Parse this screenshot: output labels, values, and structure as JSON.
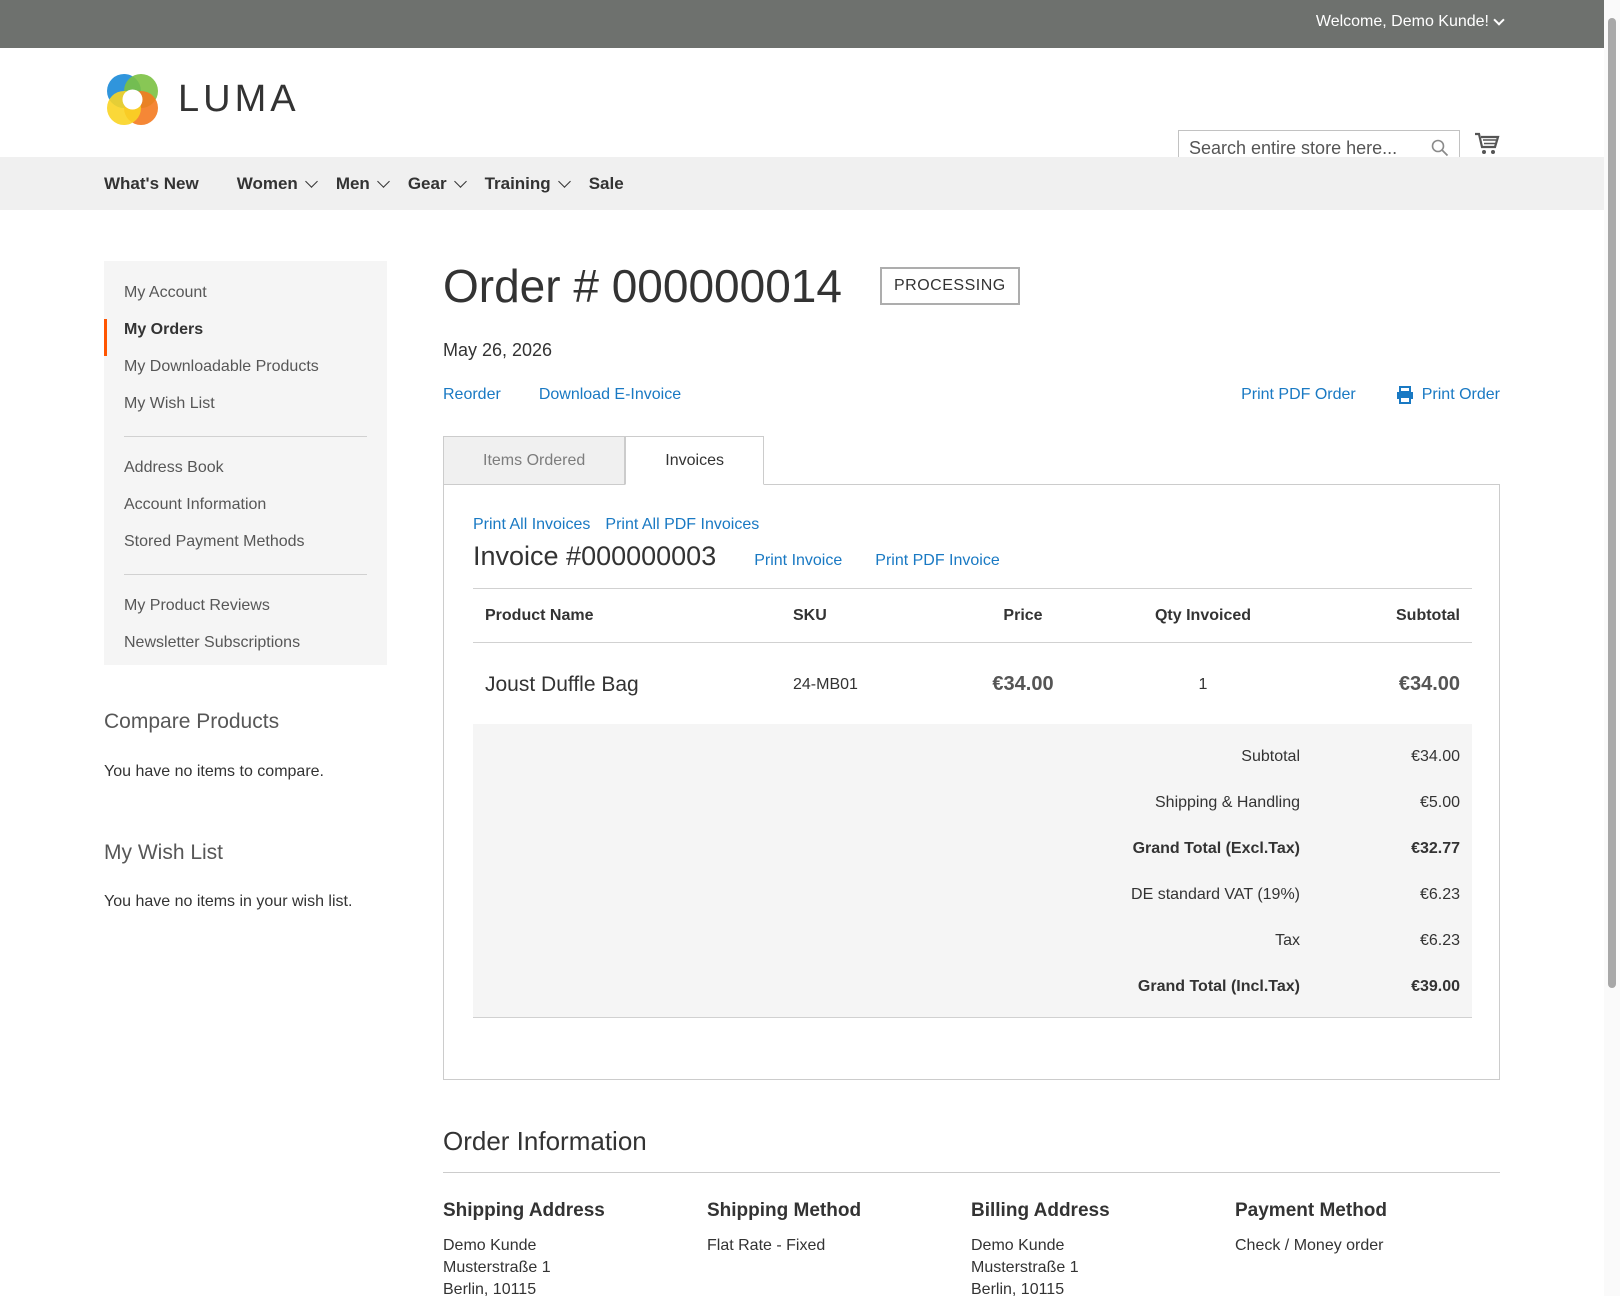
{
  "topbar": {
    "welcome": "Welcome, Demo Kunde!"
  },
  "header": {
    "logo_text": "LUMA",
    "search_placeholder": "Search entire store here...",
    "cart_icon": "cart-icon"
  },
  "nav": [
    {
      "label": "What's New",
      "has_dropdown": false
    },
    {
      "label": "Women",
      "has_dropdown": true
    },
    {
      "label": "Men",
      "has_dropdown": true
    },
    {
      "label": "Gear",
      "has_dropdown": true
    },
    {
      "label": "Training",
      "has_dropdown": true
    },
    {
      "label": "Sale",
      "has_dropdown": false
    }
  ],
  "sidebar": {
    "items": [
      {
        "label": "My Account"
      },
      {
        "label": "My Orders",
        "active": true
      },
      {
        "label": "My Downloadable Products"
      },
      {
        "label": "My Wish List"
      },
      {
        "label": "Address Book"
      },
      {
        "label": "Account Information"
      },
      {
        "label": "Stored Payment Methods"
      },
      {
        "label": "My Product Reviews"
      },
      {
        "label": "Newsletter Subscriptions"
      }
    ],
    "accent_color": "#ff5501"
  },
  "compare": {
    "title": "Compare Products",
    "text": "You have no items to compare."
  },
  "wishlist": {
    "title": "My Wish List",
    "text": "You have no items in your wish list."
  },
  "order": {
    "title": "Order # 000000014",
    "status": "Processing",
    "date": "May 26, 2026",
    "actions_left": [
      "Reorder",
      "Download E-Invoice"
    ],
    "print_pdf_order": "Print PDF Order",
    "print_order": "Print Order"
  },
  "tabs": [
    "Items Ordered",
    "Invoices"
  ],
  "invoice": {
    "print_all": "Print All Invoices",
    "print_all_pdf": "Print All PDF Invoices",
    "title": "Invoice #000000003",
    "print": "Print Invoice",
    "print_pdf": "Print PDF Invoice",
    "columns": [
      "Product Name",
      "SKU",
      "Price",
      "Qty Invoiced",
      "Subtotal"
    ],
    "rows": [
      {
        "name": "Joust Duffle Bag",
        "sku": "24-MB01",
        "price": "€34.00",
        "qty": "1",
        "subtotal": "€34.00"
      }
    ],
    "totals": [
      {
        "label": "Subtotal",
        "value": "€34.00",
        "bold": false
      },
      {
        "label": "Shipping & Handling",
        "value": "€5.00",
        "bold": false
      },
      {
        "label": "Grand Total (Excl.Tax)",
        "value": "€32.77",
        "bold": true
      },
      {
        "label": "DE standard VAT (19%)",
        "value": "€6.23",
        "bold": false
      },
      {
        "label": "Tax",
        "value": "€6.23",
        "bold": false
      },
      {
        "label": "Grand Total (Incl.Tax)",
        "value": "€39.00",
        "bold": true
      }
    ]
  },
  "order_info": {
    "title": "Order Information",
    "shipping_address": {
      "title": "Shipping Address",
      "lines": [
        "Demo Kunde",
        "Musterstraße 1",
        "Berlin, 10115"
      ]
    },
    "shipping_method": {
      "title": "Shipping Method",
      "lines": [
        "Flat Rate - Fixed"
      ]
    },
    "billing_address": {
      "title": "Billing Address",
      "lines": [
        "Demo Kunde",
        "Musterstraße 1",
        "Berlin, 10115"
      ]
    },
    "payment_method": {
      "title": "Payment Method",
      "lines": [
        "Check / Money order"
      ]
    }
  },
  "colors": {
    "topbar": "#6e716e",
    "link": "#1979c3",
    "nav_bg": "#f0f0f0"
  }
}
